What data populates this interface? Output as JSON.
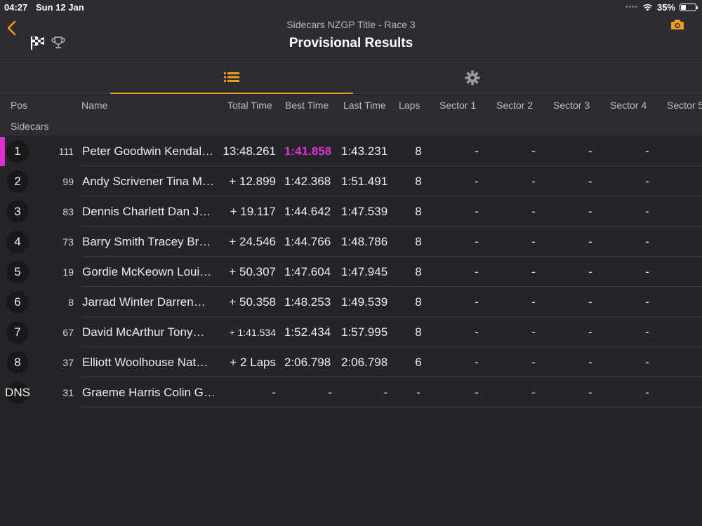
{
  "status": {
    "time": "04:27",
    "date": "Sun 12 Jan",
    "battery": "35%",
    "battery_level": 0.35
  },
  "header": {
    "subtitle": "Sidecars NZGP Title - Race 3",
    "title": "Provisional Results",
    "accent": "#f39a1e"
  },
  "table": {
    "columns": {
      "pos": "Pos",
      "name": "Name",
      "total": "Total Time",
      "best": "Best Time",
      "last": "Last Time",
      "laps": "Laps",
      "s1": "Sector 1",
      "s2": "Sector 2",
      "s3": "Sector 3",
      "s4": "Sector 4",
      "s5": "Sector 5"
    },
    "group": "Sidecars",
    "rows": [
      {
        "pos": "1",
        "num": "111",
        "name": "Peter Goodwin Kendal…",
        "total": "13:48.261",
        "best": "1:41.858",
        "last": "1:43.231",
        "laps": "8",
        "s1": "-",
        "s2": "-",
        "s3": "-",
        "s4": "-"
      },
      {
        "pos": "2",
        "num": "99",
        "name": "Andy Scrivener Tina M…",
        "total": "+ 12.899",
        "best": "1:42.368",
        "last": "1:51.491",
        "laps": "8",
        "s1": "-",
        "s2": "-",
        "s3": "-",
        "s4": "-"
      },
      {
        "pos": "3",
        "num": "83",
        "name": "Dennis Charlett Dan J…",
        "total": "+ 19.117",
        "best": "1:44.642",
        "last": "1:47.539",
        "laps": "8",
        "s1": "-",
        "s2": "-",
        "s3": "-",
        "s4": "-"
      },
      {
        "pos": "4",
        "num": "73",
        "name": "Barry Smith Tracey Br…",
        "total": "+ 24.546",
        "best": "1:44.766",
        "last": "1:48.786",
        "laps": "8",
        "s1": "-",
        "s2": "-",
        "s3": "-",
        "s4": "-"
      },
      {
        "pos": "5",
        "num": "19",
        "name": "Gordie McKeown Loui…",
        "total": "+ 50.307",
        "best": "1:47.604",
        "last": "1:47.945",
        "laps": "8",
        "s1": "-",
        "s2": "-",
        "s3": "-",
        "s4": "-"
      },
      {
        "pos": "6",
        "num": "8",
        "name": "Jarrad Winter Darren…",
        "total": "+ 50.358",
        "best": "1:48.253",
        "last": "1:49.539",
        "laps": "8",
        "s1": "-",
        "s2": "-",
        "s3": "-",
        "s4": "-"
      },
      {
        "pos": "7",
        "num": "67",
        "name": "David McArthur Tony…",
        "total": "+ 1:41.534",
        "best": "1:52.434",
        "last": "1:57.995",
        "laps": "8",
        "s1": "-",
        "s2": "-",
        "s3": "-",
        "s4": "-"
      },
      {
        "pos": "8",
        "num": "37",
        "name": "Elliott Woolhouse Nat…",
        "total": "+ 2 Laps",
        "best": "2:06.798",
        "last": "2:06.798",
        "laps": "6",
        "s1": "-",
        "s2": "-",
        "s3": "-",
        "s4": "-"
      },
      {
        "pos": "DNS",
        "num": "31",
        "name": "Graeme Harris Colin G…",
        "total": "-",
        "best": "-",
        "last": "-",
        "laps": "-",
        "s1": "-",
        "s2": "-",
        "s3": "-",
        "s4": "-"
      }
    ]
  }
}
